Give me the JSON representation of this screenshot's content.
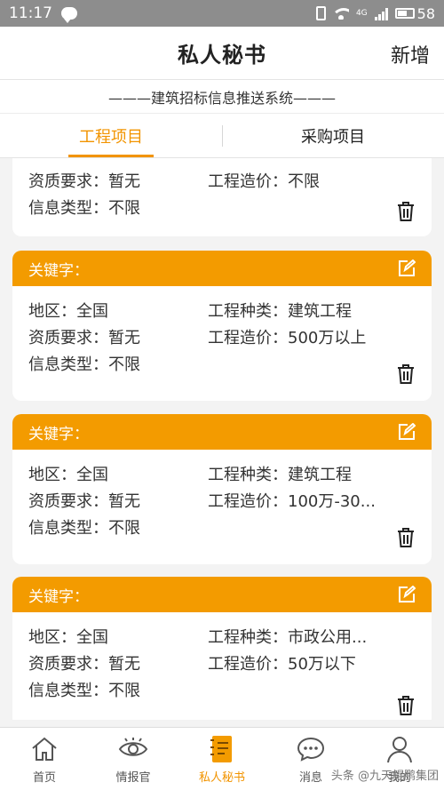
{
  "status_bar": {
    "time": "11:17",
    "network": "4G",
    "battery": "58"
  },
  "header": {
    "title": "私人秘书",
    "add_label": "新增"
  },
  "subtitle": "———建筑招标信息推送系统———",
  "tabs": [
    {
      "label": "工程项目",
      "active": true
    },
    {
      "label": "采购项目",
      "active": false
    }
  ],
  "partial_card": {
    "rows": [
      {
        "c1": "资质要求：暂无",
        "c2": "工程造价：不限"
      },
      {
        "c1": "信息类型：不限",
        "c2": ""
      }
    ]
  },
  "cards": [
    {
      "keyword_label": "关键字：",
      "region": "地区：全国",
      "type": "工程种类：建筑工程",
      "qualification": "资质要求：暂无",
      "cost": "工程造价：500万以上",
      "info_type": "信息类型：不限"
    },
    {
      "keyword_label": "关键字：",
      "region": "地区：全国",
      "type": "工程种类：建筑工程",
      "qualification": "资质要求：暂无",
      "cost": "工程造价：100万-30...",
      "info_type": "信息类型：不限"
    },
    {
      "keyword_label": "关键字：",
      "region": "地区：全国",
      "type": "工程种类：市政公用...",
      "qualification": "资质要求：暂无",
      "cost": "工程造价：50万以下",
      "info_type": "信息类型：不限"
    }
  ],
  "bottom_nav": [
    {
      "label": "首页",
      "icon": "home-icon"
    },
    {
      "label": "情报官",
      "icon": "eye-icon"
    },
    {
      "label": "私人秘书",
      "icon": "notebook-icon",
      "active": true
    },
    {
      "label": "消息",
      "icon": "message-icon"
    },
    {
      "label": "我的",
      "icon": "person-icon"
    }
  ],
  "watermark": "头条 @九天鲲鹏集团",
  "colors": {
    "accent": "#f39b00",
    "background": "#f3f3f3"
  }
}
